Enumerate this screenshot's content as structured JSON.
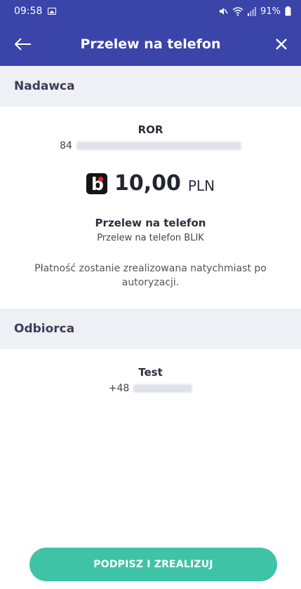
{
  "status_bar": {
    "time": "09:58",
    "battery": "91%"
  },
  "appbar": {
    "title": "Przelew na telefon"
  },
  "sender": {
    "header": "Nadawca",
    "account_name": "ROR",
    "account_number_prefix": "84"
  },
  "payment": {
    "amount": "10,00",
    "currency": "PLN",
    "type_title": "Przelew na telefon",
    "type_subtitle": "Przelew na telefon BLIK",
    "note": "Płatność zostanie zrealizowana natychmiast po autoryzacji."
  },
  "recipient": {
    "header": "Odbiorca",
    "name": "Test",
    "phone_prefix": "+48"
  },
  "actions": {
    "submit_label": "PODPISZ I ZREALIZUJ"
  },
  "colors": {
    "primary": "#3b44a8",
    "section_bg": "#eef0f6",
    "accent": "#3fc3a6",
    "blik_red": "#e8202e"
  }
}
